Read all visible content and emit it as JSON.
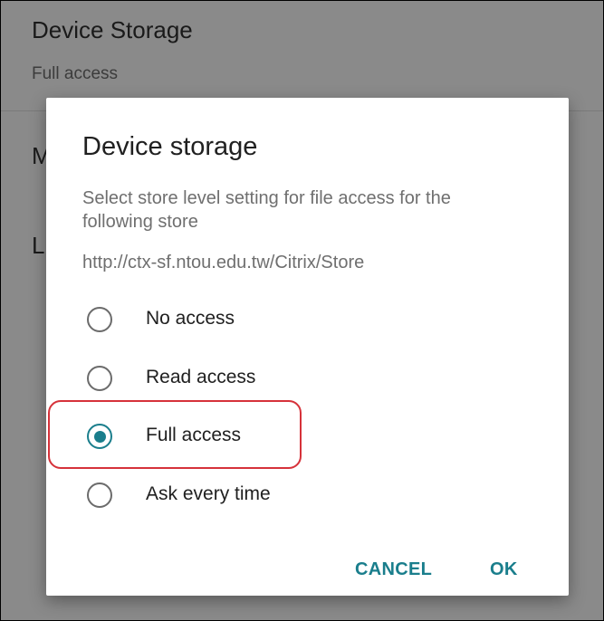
{
  "background": {
    "items": [
      {
        "title": "Device Storage",
        "subtitle": "Full access"
      },
      {
        "title": "M"
      },
      {
        "title": "L"
      }
    ]
  },
  "dialog": {
    "title": "Device storage",
    "message": "Select store level setting for file access for the following store",
    "url": "http://ctx-sf.ntou.edu.tw/Citrix/Store",
    "options": [
      {
        "label": "No access",
        "selected": false
      },
      {
        "label": "Read access",
        "selected": false
      },
      {
        "label": "Full access",
        "selected": true
      },
      {
        "label": "Ask every time",
        "selected": false
      }
    ],
    "buttons": {
      "cancel": "CANCEL",
      "ok": "OK"
    }
  },
  "colors": {
    "accent": "#1a7e8c",
    "highlight": "#d6323a",
    "scrim": "#8a8a8a"
  }
}
